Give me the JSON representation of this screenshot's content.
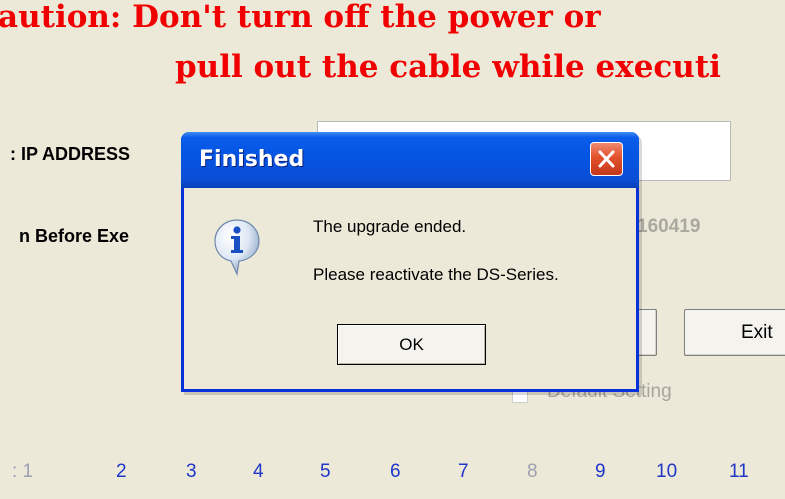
{
  "banner": {
    "line1": "aution: Don't turn off the power or",
    "line2": "pull out the cable while executi"
  },
  "fields": {
    "ip_label": ": IP ADDRESS",
    "ip_value": "",
    "version_label": "n Before Exe",
    "version_value": "160419"
  },
  "buttons": {
    "exit_label": "Exit"
  },
  "default_setting": {
    "label": "Default Setting",
    "checked": false
  },
  "page_numbers": [
    {
      "label": ":  1",
      "muted": true
    },
    {
      "label": "2",
      "muted": false
    },
    {
      "label": "3",
      "muted": false
    },
    {
      "label": "4",
      "muted": false
    },
    {
      "label": "5",
      "muted": false
    },
    {
      "label": "6",
      "muted": false
    },
    {
      "label": "7",
      "muted": false
    },
    {
      "label": "8",
      "muted": true
    },
    {
      "label": "9",
      "muted": false
    },
    {
      "label": "10",
      "muted": false
    },
    {
      "label": "11",
      "muted": false
    }
  ],
  "dialog": {
    "title": "Finished",
    "message_line1": "The upgrade ended.",
    "message_line2": "Please reactivate the DS-Series.",
    "ok_label": "OK",
    "icon": "info-icon"
  },
  "colors": {
    "caution_red": "#f00000",
    "page_number_blue": "#1f36c9",
    "titlebar_blue": "#0554e3",
    "close_red": "#e2512c"
  }
}
